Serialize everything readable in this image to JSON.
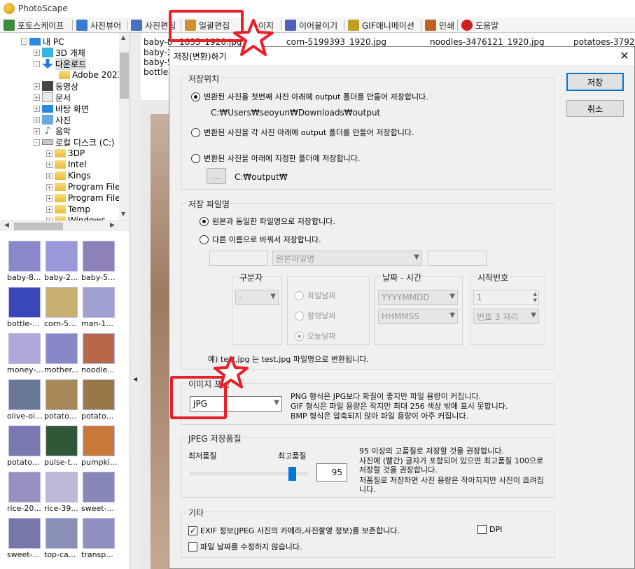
{
  "app": {
    "title": "PhotoScape"
  },
  "tabs": [
    {
      "label": "포토스케이프",
      "color": "#3c8c3c"
    },
    {
      "label": "사진뷰어",
      "color": "#3a7ad0"
    },
    {
      "label": "사진편집",
      "color": "#4a6ec0"
    },
    {
      "label": "일괄편집",
      "color": "#d09030"
    },
    {
      "label": "이지",
      "color": "#c04040"
    },
    {
      "label": "이어붙이기",
      "color": "#5060c0"
    },
    {
      "label": "GIF애니메이션",
      "color": "#c0a020"
    },
    {
      "label": "인쇄",
      "color": "#c06020"
    },
    {
      "label": "도움말",
      "color": "#d02020"
    }
  ],
  "tree": [
    {
      "label": "내 PC",
      "indent": 0,
      "icon": "pc-icon"
    },
    {
      "label": "3D 개체",
      "indent": 1,
      "icon": "cube-icon"
    },
    {
      "label": "다운로드",
      "indent": 1,
      "icon": "download-icon"
    },
    {
      "label": "Adobe 2021",
      "indent": 2,
      "icon": "folder-icon"
    },
    {
      "label": "동영상",
      "indent": 1,
      "icon": "video-icon"
    },
    {
      "label": "문서",
      "indent": 1,
      "icon": "document-icon"
    },
    {
      "label": "바탕 화면",
      "indent": 1,
      "icon": "desktop-icon"
    },
    {
      "label": "사진",
      "indent": 1,
      "icon": "pictures-icon"
    },
    {
      "label": "음악",
      "indent": 1,
      "icon": "music-icon"
    },
    {
      "label": "로컬 디스크 (C:)",
      "indent": 1,
      "icon": "drive-icon"
    },
    {
      "label": "3DP",
      "indent": 2,
      "icon": "folder-icon"
    },
    {
      "label": "Intel",
      "indent": 2,
      "icon": "folder-icon"
    },
    {
      "label": "Kings",
      "indent": 2,
      "icon": "folder-icon"
    },
    {
      "label": "Program File",
      "indent": 2,
      "icon": "folder-icon"
    },
    {
      "label": "Program File",
      "indent": 2,
      "icon": "folder-icon"
    },
    {
      "label": "Temp",
      "indent": 2,
      "icon": "folder-icon"
    },
    {
      "label": "Windows",
      "indent": 2,
      "icon": "folder-icon"
    }
  ],
  "thumbnails": [
    {
      "label": "baby-8...",
      "color": "#8a88c8"
    },
    {
      "label": "baby-2...",
      "color": "#9a98d8"
    },
    {
      "label": "baby-5...",
      "color": "#8e80b8"
    },
    {
      "label": "bottle-...",
      "color": "#3848b8"
    },
    {
      "label": "corn-5...",
      "color": "#c8b070"
    },
    {
      "label": "man-1...",
      "color": "#a0a0d0"
    },
    {
      "label": "money-...",
      "color": "#b0a8d8"
    },
    {
      "label": "mother...",
      "color": "#8888c8"
    },
    {
      "label": "noodle...",
      "color": "#b86848"
    },
    {
      "label": "olive-oi...",
      "color": "#6a7898"
    },
    {
      "label": "potato...",
      "color": "#a88858"
    },
    {
      "label": "potato...",
      "color": "#987848"
    },
    {
      "label": "potato...",
      "color": "#7a78b0"
    },
    {
      "label": "pulse-t...",
      "color": "#305838"
    },
    {
      "label": "pumpki...",
      "color": "#c87838"
    },
    {
      "label": "rice-20...",
      "color": "#9890c0"
    },
    {
      "label": "rice-39...",
      "color": "#c0b8d8"
    },
    {
      "label": "sweet-...",
      "color": "#8888b8"
    },
    {
      "label": "sweet-...",
      "color": "#7878a8"
    },
    {
      "label": "top-ca...",
      "color": "#8890b8"
    },
    {
      "label": "transp...",
      "color": "#9090c0"
    }
  ],
  "files": {
    "row1": [
      "baby-8",
      "1635_1920.jpg",
      "corn-5199393_1920.jpg",
      "noodles-3476121_1920.jpg",
      "potatoes-37926"
    ],
    "others": [
      "baby-2",
      "baby-5",
      "bottle-"
    ]
  },
  "dialog": {
    "title": "저장(변환)하기",
    "close": "✕",
    "save_button": "저장",
    "cancel_button": "취소",
    "location": {
      "legend": "저장위치",
      "opt1": "변환된 사진을 첫번째 사진 아래에 output 폴더를 만들어 저장합니다.",
      "path1": "C:₩Users₩seoyun₩Downloads₩output",
      "opt2": "변환된 사진을 각 사진 아래에 output 폴더를 만들어 저장합니다.",
      "opt3": "변환된 사진을 아래에 지정한 폴더에 저장합니다.",
      "browse": "...",
      "path3": "C:₩output₩"
    },
    "filename": {
      "legend": "저장 파일명",
      "opt1": "원본과 동일한 파일명으로 저장합니다.",
      "opt2": "다른 이름으로 바꿔서 저장합니다.",
      "name_combo": "원본파일명",
      "sep_legend": "구분자",
      "sep_value": "-",
      "date_radio1": "파일날짜",
      "date_radio2": "촬영날짜",
      "date_radio3": "오늘날짜",
      "datetime_legend": "날짜 - 시간",
      "date_format": "YYYYMMDD",
      "time_format": "HHMMSS",
      "start_legend": "시작번호",
      "start_value": "1",
      "digits": "번호 3 자리",
      "example": "예) test.jpg 는 test.jpg  파일명으로 변환됩니다."
    },
    "format": {
      "legend": "이미지 포맷",
      "value": "JPG",
      "desc1": "PNG 형식은 JPG보다 화질이 좋지만 파일 용량이 커집니다.",
      "desc2": "GIF 형식은 파일 용량은 작지만 최대 256 색상 밖에 표시 못합니다.",
      "desc3": "BMP 형식은 압축되지 않아 파일 용량이 아주 커집니다."
    },
    "quality": {
      "legend": "JPEG 저장품질",
      "min_label": "최저품질",
      "max_label": "최고품질",
      "value": "95",
      "slider_fraction": 0.95,
      "note1": "95 이상의 고품질로 저장할 것을 권장합니다.",
      "note2": "사진에 (빨간) 글자가 포함되어 있으면 최고품질 100으로",
      "note3": "저장할 것을 권장합니다.",
      "note4": "저품질로 저장하면 사진 용량은 작아지지만 사진이 흐려집",
      "note5": "니다."
    },
    "etc": {
      "legend": "기타",
      "exif": "EXIF 정보(JPEG 사진의 카메라,사진촬영 정보)를 보존합니다.",
      "exif_checked": "✓",
      "dpi": "DPI",
      "filedate": "파일 날짜를 수정하지 않습니다."
    }
  },
  "colors": {
    "highlight": "#e8202a",
    "accent": "#0078d7"
  }
}
